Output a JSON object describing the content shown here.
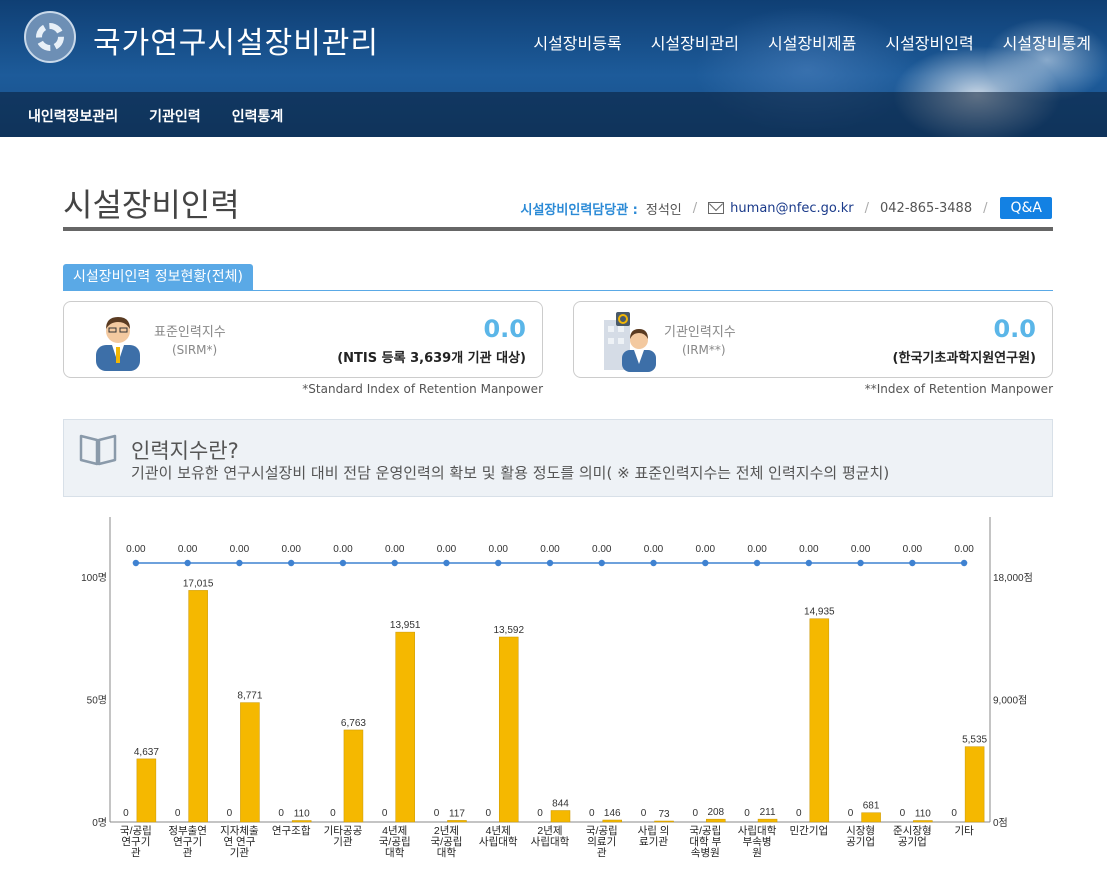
{
  "header": {
    "site_title": "국가연구시설장비관리",
    "gnb": [
      "시설장비등록",
      "시설장비관리",
      "시설장비제품",
      "시설장비인력",
      "시설장비통계"
    ],
    "lnb": [
      "내인력정보관리",
      "기관인력",
      "인력통계"
    ]
  },
  "page": {
    "title": "시설장비인력",
    "contact_label": "시설장비인력담당관 :",
    "contact_name": "정석인",
    "email": "human@nfec.go.kr",
    "phone": "042-865-3488",
    "qa": "Q&A"
  },
  "section_tab": "시설장비인력 정보현황(전체)",
  "card_sirm": {
    "label": "표준인력지수",
    "sub": "(SIRM*)",
    "value": "0.0",
    "desc": "(NTIS 등록 3,639개 기관 대상)",
    "footnote": "*Standard Index of Retention Manpower"
  },
  "card_irm": {
    "label": "기관인력지수",
    "sub": "(IRM**)",
    "value": "0.0",
    "desc": "(한국기초과학지원연구원)",
    "footnote": "**Index of Retention Manpower"
  },
  "info": {
    "title": "인력지수란?",
    "desc": "기관이 보유한 연구시설장비 대비 전담 운영인력의 확보 및 활용 정도를 의미( ※ 표준인력지수는 전체 인력지수의 평균치)"
  },
  "icons": {
    "person": "person-icon",
    "building-person": "building-person-icon",
    "mail": "mail-icon",
    "book": "book-icon",
    "logo": "gear-logo-icon"
  },
  "colors": {
    "bar": "#f5b800",
    "line": "#3f82d1",
    "accent": "#1381e3",
    "tab": "#5aa9e6",
    "value": "#5bb6e8"
  },
  "chart_data": {
    "type": "bar",
    "categories": [
      [
        "국/공립",
        "연구기",
        "관"
      ],
      [
        "정부출연",
        "연구기",
        "관"
      ],
      [
        "지자체출",
        "연 연구",
        "기관"
      ],
      [
        "연구조합"
      ],
      [
        "기타공공",
        "기관"
      ],
      [
        "4년제",
        "국/공립",
        "대학"
      ],
      [
        "2년제",
        "국/공립",
        "대학"
      ],
      [
        "4년제",
        "사립대학"
      ],
      [
        "2년제",
        "사립대학"
      ],
      [
        "국/공립",
        "의료기",
        "관"
      ],
      [
        "사립 의",
        "료기관"
      ],
      [
        "국/공립",
        "대학 부",
        "속병원"
      ],
      [
        "사립대학",
        "부속병",
        "원"
      ],
      [
        "민간기업"
      ],
      [
        "시장형",
        "공기업"
      ],
      [
        "준시장형",
        "공기업"
      ],
      [
        "기타"
      ]
    ],
    "series": [
      {
        "values": [
          0,
          0,
          0,
          0,
          0,
          0,
          0,
          0,
          0,
          0,
          0,
          0,
          0,
          0,
          0,
          0,
          0
        ]
      },
      {
        "values": [
          4637,
          17015,
          8771,
          110,
          6763,
          13951,
          117,
          13592,
          844,
          146,
          73,
          208,
          211,
          14935,
          681,
          110,
          5535
        ]
      },
      {
        "values": [
          0,
          0,
          0,
          0,
          0,
          0,
          0,
          0,
          0,
          0,
          0,
          0,
          0,
          0,
          0,
          0,
          0
        ]
      }
    ],
    "series_labels": [
      [
        "0",
        "0",
        "0",
        "0",
        "0",
        "0",
        "0",
        "0",
        "0",
        "0",
        "0",
        "0",
        "0",
        "0",
        "0",
        "0",
        "0"
      ],
      [
        "4,637",
        "17,015",
        "8,771",
        "110",
        "6,763",
        "13,951",
        "117",
        "13,592",
        "844",
        "146",
        "73",
        "208",
        "211",
        "14,935",
        "681",
        "110",
        "5,535"
      ],
      [
        "0.00",
        "0.00",
        "0.00",
        "0.00",
        "0.00",
        "0.00",
        "0.00",
        "0.00",
        "0.00",
        "0.00",
        "0.00",
        "0.00",
        "0.00",
        "0.00",
        "0.00",
        "0.00",
        "0.00"
      ]
    ],
    "y_left": {
      "ticks": [
        "0명",
        "50명",
        "100명"
      ],
      "range": [
        0,
        100
      ]
    },
    "y_right": {
      "ticks": [
        "0점",
        "9,000점",
        "18,000점"
      ],
      "range": [
        0,
        18000
      ]
    }
  }
}
